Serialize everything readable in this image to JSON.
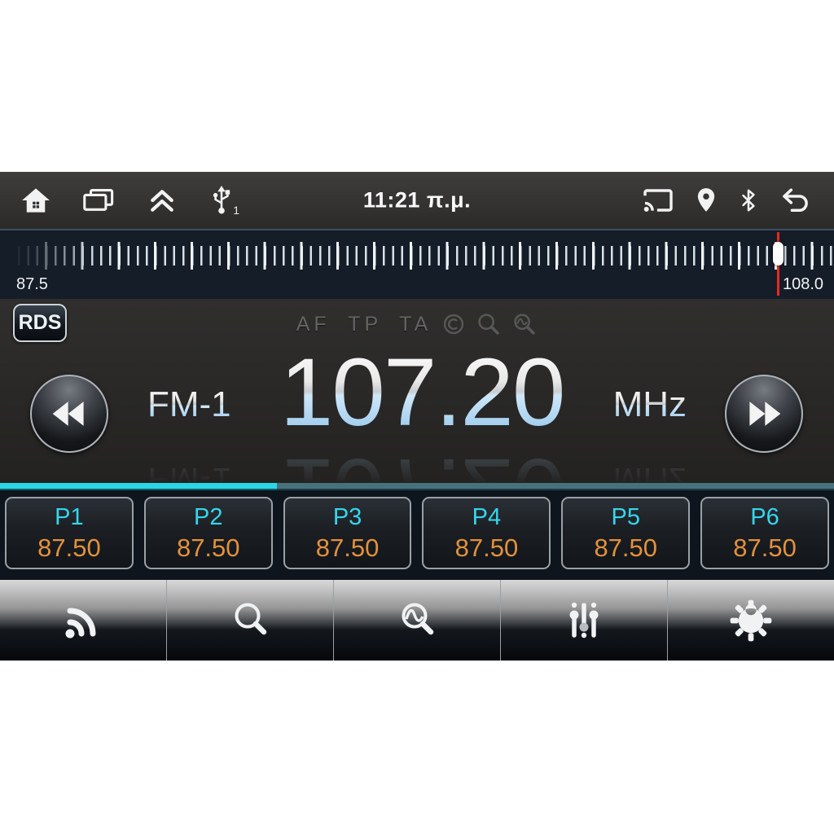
{
  "status_bar": {
    "time": "11:21 π.μ.",
    "usb_device_count": "1",
    "left_icons": [
      "home-icon",
      "recent-apps-icon",
      "collapse-up-icon",
      "usb-icon"
    ],
    "right_icons": [
      "cast-icon",
      "location-icon",
      "bluetooth-icon",
      "back-icon"
    ]
  },
  "tuner_scale": {
    "min_label": "87.5",
    "max_label": "108.0"
  },
  "display": {
    "rds_badge": "RDS",
    "flags": "AF TP TA",
    "flag_icons": [
      "pty-circle-icon",
      "search-icon",
      "scan-icon"
    ],
    "band": "FM-1",
    "frequency": "107.20",
    "unit": "MHz"
  },
  "presets": [
    {
      "label": "P1",
      "value": "87.50"
    },
    {
      "label": "P2",
      "value": "87.50"
    },
    {
      "label": "P3",
      "value": "87.50"
    },
    {
      "label": "P4",
      "value": "87.50"
    },
    {
      "label": "P5",
      "value": "87.50"
    },
    {
      "label": "P6",
      "value": "87.50"
    }
  ],
  "toolbar": {
    "buttons": [
      "broadcast-icon",
      "search-icon",
      "scan-icon",
      "equalizer-icon",
      "settings-gear-icon"
    ]
  },
  "colors": {
    "accent_cyan": "#2ad7e7",
    "accent_cyan_dim": "#47727c",
    "preset_label_cyan": "#35d6ec",
    "preset_value_orange": "#e2913c",
    "tuning_indicator_red": "#e8281e",
    "frequency_blue": "#8ec3e8"
  }
}
